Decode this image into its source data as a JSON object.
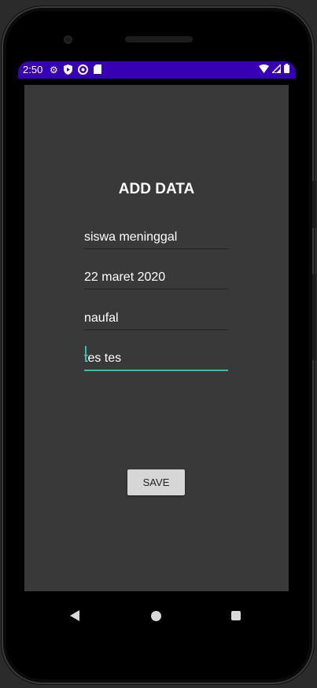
{
  "status_bar": {
    "time": "2:50",
    "left_icons": [
      "gear-icon",
      "shield-icon",
      "vpn-icon",
      "sd-card-icon"
    ],
    "right_icons": [
      "wifi-icon",
      "signal-icon",
      "battery-icon"
    ],
    "background_color": "#3700b3"
  },
  "form": {
    "title": "ADD DATA",
    "fields": [
      {
        "value": "siswa meninggal"
      },
      {
        "value": "22 maret 2020"
      },
      {
        "value": "naufal"
      },
      {
        "value": "tes tes"
      }
    ],
    "save_label": "SAVE",
    "accent_color": "#26c6b6"
  },
  "nav_bar": {
    "buttons": [
      "back-icon",
      "home-icon",
      "recents-icon"
    ]
  }
}
